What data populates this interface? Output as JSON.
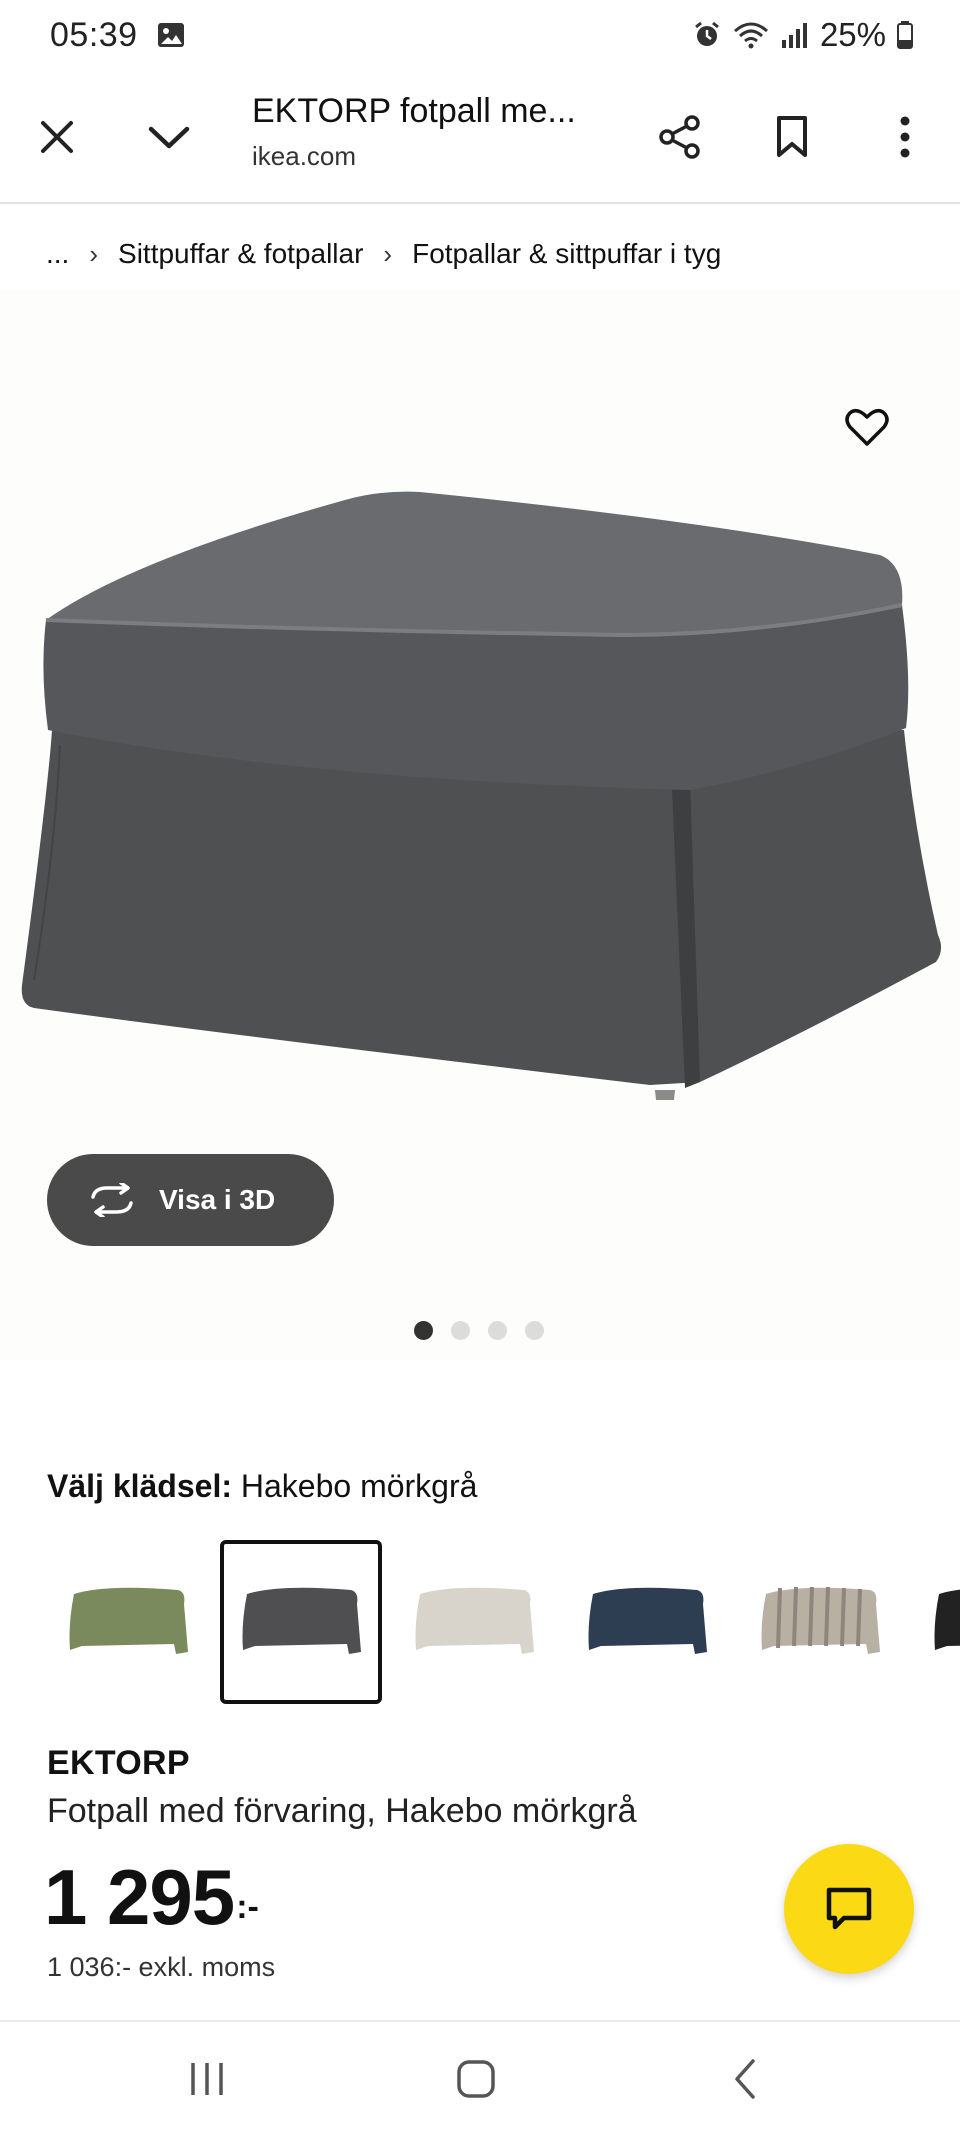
{
  "status_bar": {
    "time": "05:39",
    "battery": "25%",
    "icons": [
      "gallery-icon",
      "alarm-icon",
      "wifi-icon",
      "signal-icon",
      "battery-icon"
    ]
  },
  "toolbar": {
    "title": "EKTORP fotpall me...",
    "domain": "ikea.com",
    "icons": [
      "close-icon",
      "chevron-down-icon",
      "share-icon",
      "bookmark-icon",
      "more-vertical-icon"
    ]
  },
  "breadcrumb": {
    "ellipsis": "...",
    "items": [
      "Sittpuffar & fotpallar",
      "Fotpallar & sittpuffar i tyg"
    ]
  },
  "gallery": {
    "view_3d_label": "Visa i 3D",
    "dot_count": 4,
    "active_index": 0
  },
  "variant": {
    "label": "Välj klädsel:",
    "value": "Hakebo mörkgrå",
    "swatches": [
      {
        "color": "#7b8a5c",
        "selected": false
      },
      {
        "color": "#4f4f51",
        "selected": true
      },
      {
        "color": "#d8d4cb",
        "selected": false
      },
      {
        "color": "#2d3d52",
        "selected": false
      },
      {
        "color": "#b9b0a4",
        "selected": false
      },
      {
        "color": "#222222",
        "selected": false
      }
    ]
  },
  "product": {
    "brand": "EKTORP",
    "description": "Fotpall med förvaring, Hakebo mörkgrå",
    "price": "1 295",
    "price_suffix": ":-",
    "price_excl_vat": "1 036:- exkl. moms"
  },
  "colors": {
    "accent_yellow": "#fbd914",
    "button_dark": "#4a4a4a",
    "product_gray": "#545557"
  }
}
